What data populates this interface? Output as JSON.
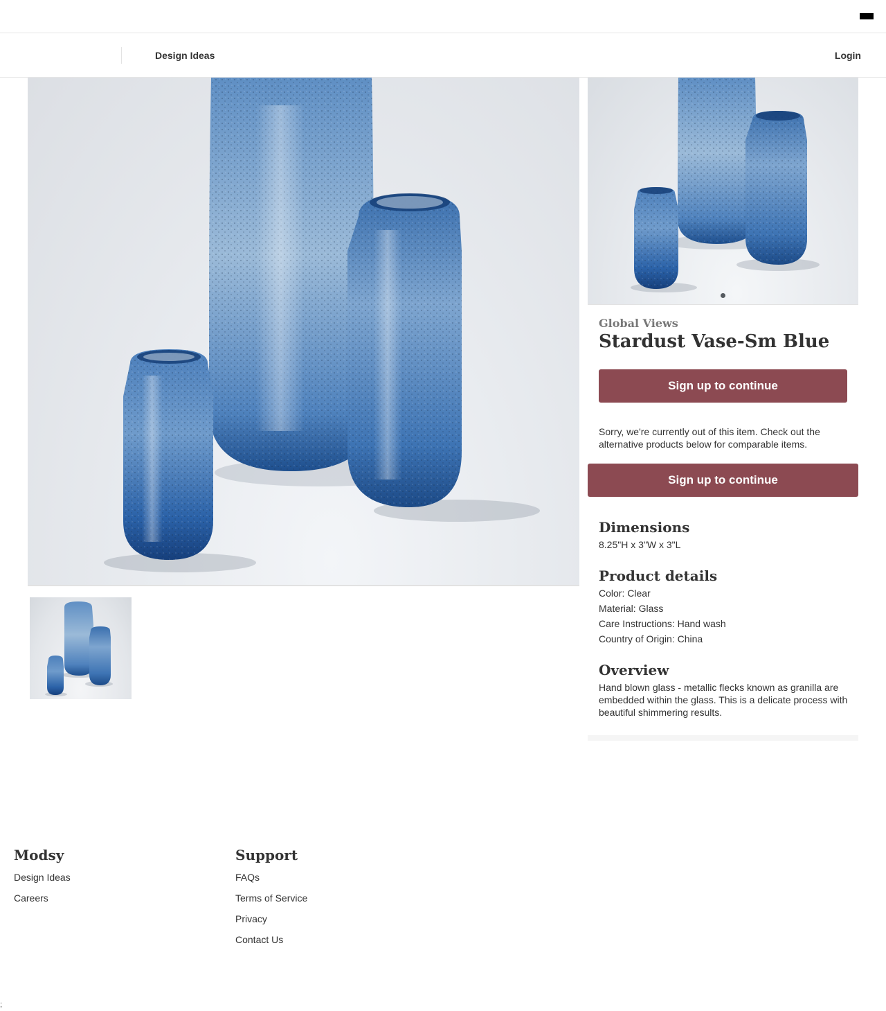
{
  "header": {
    "menu_icon": "hamburger-menu-icon"
  },
  "nav": {
    "design_ideas": "Design Ideas",
    "login": "Login"
  },
  "product": {
    "brand": "Global Views",
    "title": "Stardust Vase-Sm Blue",
    "cta_primary": "Sign up to continue",
    "out_of_stock_message": "Sorry, we're currently out of this item. Check out the alternative products below for comparable items.",
    "cta_secondary": "Sign up to continue",
    "dimensions": {
      "heading": "Dimensions",
      "value": "8.25\"H x 3\"W x 3\"L"
    },
    "details": {
      "heading": "Product details",
      "items": [
        "Color: Clear",
        "Material: Glass",
        "Care Instructions: Hand wash",
        "Country of Origin: China"
      ]
    },
    "overview": {
      "heading": "Overview",
      "text": "Hand blown glass - metallic flecks known as granilla are embedded within the glass.  This is a delicate process with beautiful shimmering results."
    },
    "image_colors": {
      "glass_dark": "#1d4e8c",
      "glass_mid": "#3f78b8",
      "glass_light": "#9ab8d6"
    }
  },
  "footer": {
    "modsy": {
      "heading": "Modsy",
      "links": [
        "Design Ideas",
        "Careers"
      ]
    },
    "support": {
      "heading": "Support",
      "links": [
        "FAQs",
        "Terms of Service",
        "Privacy",
        "Contact Us"
      ]
    }
  },
  "stray_char": ";"
}
